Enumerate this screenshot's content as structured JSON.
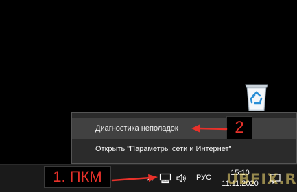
{
  "context_menu": {
    "items": [
      {
        "label": "Диагностика неполадок"
      },
      {
        "label": "Открыть \"Параметры сети и Интернет\""
      }
    ]
  },
  "taskbar": {
    "language": "РУС",
    "clock_time": "15:10",
    "clock_date": "11.11.2020"
  },
  "annotations": {
    "step1": "1. ПКМ",
    "step2": "2",
    "color": "#e8312a"
  },
  "watermark": "UBFIX.RU",
  "icons": {
    "desktop": "recycle-bin-icon",
    "tray": [
      "tray-chevron-icon",
      "network-icon",
      "volume-icon",
      "notifications-icon"
    ]
  }
}
